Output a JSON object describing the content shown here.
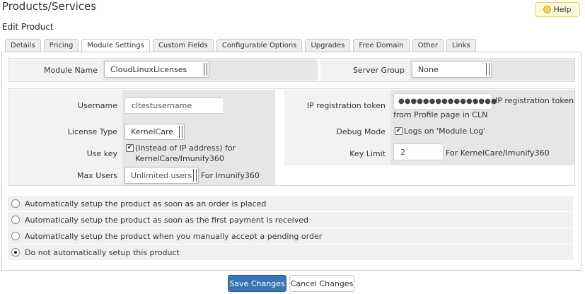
{
  "header": {
    "title": "Products/Services",
    "help_label": "Help",
    "subtitle": "Edit Product"
  },
  "tabs": [
    {
      "label": "Details"
    },
    {
      "label": "Pricing"
    },
    {
      "label": "Module Settings",
      "active": true
    },
    {
      "label": "Custom Fields"
    },
    {
      "label": "Configurable Options"
    },
    {
      "label": "Upgrades"
    },
    {
      "label": "Free Domain"
    },
    {
      "label": "Other"
    },
    {
      "label": "Links"
    }
  ],
  "module": {
    "module_name_label": "Module Name",
    "module_name_value": "CloudLinuxLicenses",
    "server_group_label": "Server Group",
    "server_group_value": "None"
  },
  "settings": {
    "username_label": "Username",
    "username_value": "cltestusername",
    "license_type_label": "License Type",
    "license_type_value": "KernelCare",
    "use_key_label": "Use key",
    "use_key_checked": true,
    "use_key_desc_line1": "(Instead of IP address) for",
    "use_key_desc_line2": "KernelCare/Imunify360",
    "max_users_label": "Max Users",
    "max_users_value": "Unlimited users",
    "max_users_desc": "For Imunify360",
    "ip_token_label": "IP registration token",
    "ip_token_value": "●●●●●●●●●●●●●●●●",
    "ip_token_desc_line1": "IP registration token",
    "ip_token_desc_line2": "from Profile page in CLN",
    "debug_label": "Debug Mode",
    "debug_checked": true,
    "debug_desc": "Logs on 'Module Log'",
    "key_limit_label": "Key Limit",
    "key_limit_value": "2",
    "key_limit_desc": "For KernelCare/Imunify360"
  },
  "setup_options": [
    {
      "label": "Automatically setup the product as soon as an order is placed",
      "selected": false
    },
    {
      "label": "Automatically setup the product as soon as the first payment is received",
      "selected": false
    },
    {
      "label": "Automatically setup the product when you manually accept a pending order",
      "selected": false
    },
    {
      "label": "Do not automatically setup this product",
      "selected": true
    }
  ],
  "actions": {
    "save_label": "Save Changes",
    "cancel_label": "Cancel Changes"
  },
  "colors": {
    "primary_button": "#3a76b6",
    "help_background": "#fdfbd7"
  },
  "icons": {
    "help": "lightbulb-icon",
    "checkbox": "checkmark-icon",
    "select": "dropdown-arrow-icon"
  }
}
